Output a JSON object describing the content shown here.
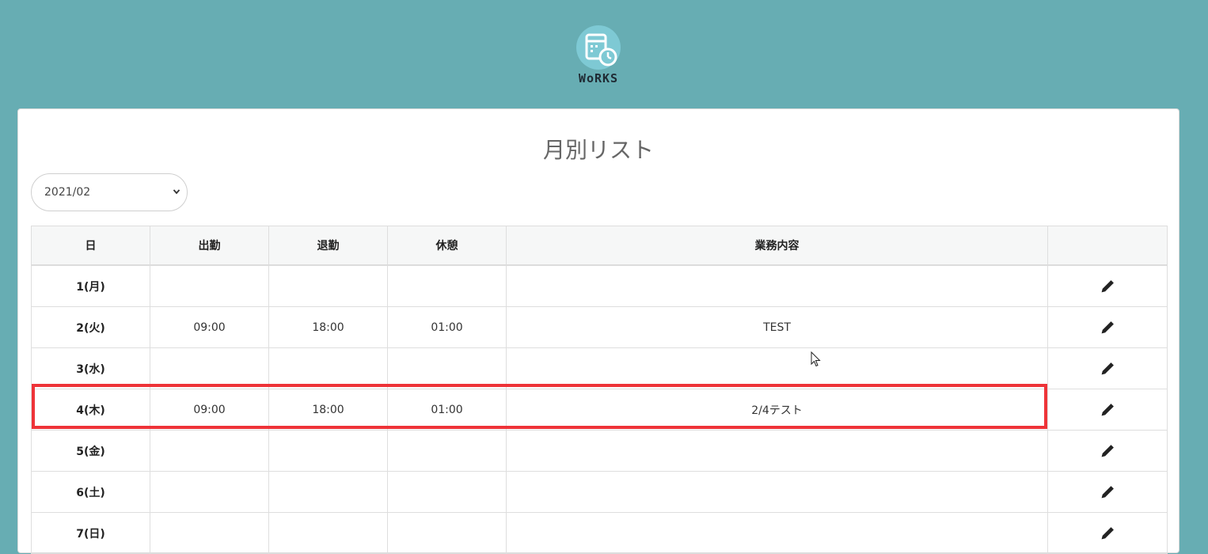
{
  "header": {
    "logo_text": "WoRKS"
  },
  "page": {
    "title": "月別リスト"
  },
  "month_select": {
    "selected": "2021/02"
  },
  "table": {
    "columns": [
      "日",
      "出勤",
      "退勤",
      "休憩",
      "業務内容",
      ""
    ],
    "rows": [
      {
        "day": "1(月)",
        "start": "",
        "end": "",
        "break": "",
        "work": ""
      },
      {
        "day": "2(火)",
        "start": "09:00",
        "end": "18:00",
        "break": "01:00",
        "work": "TEST"
      },
      {
        "day": "3(水)",
        "start": "",
        "end": "",
        "break": "",
        "work": ""
      },
      {
        "day": "4(木)",
        "start": "09:00",
        "end": "18:00",
        "break": "01:00",
        "work": "2/4テスト"
      },
      {
        "day": "5(金)",
        "start": "",
        "end": "",
        "break": "",
        "work": ""
      },
      {
        "day": "6(土)",
        "start": "",
        "end": "",
        "break": "",
        "work": ""
      },
      {
        "day": "7(日)",
        "start": "",
        "end": "",
        "break": "",
        "work": ""
      }
    ]
  },
  "icons": {
    "edit": "pencil-icon",
    "logo": "calendar-clock-icon",
    "select_arrow": "chevron-down-icon"
  },
  "colors": {
    "background": "#67adb3",
    "highlight": "#ee3338",
    "logo_circle": "#7ec9d4"
  }
}
